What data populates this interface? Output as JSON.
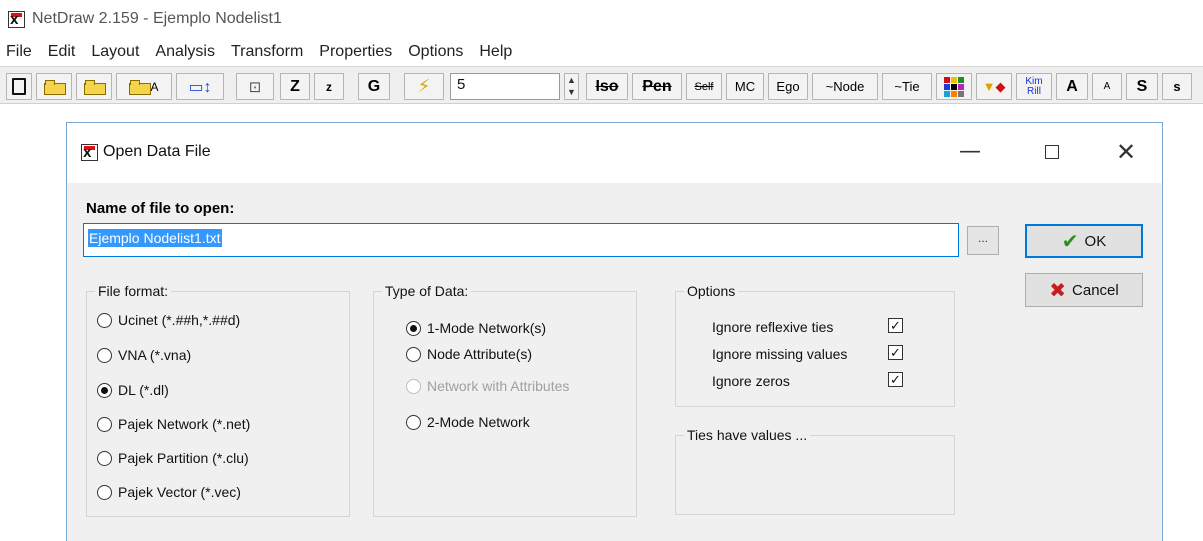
{
  "app": {
    "title": "NetDraw 2.159 - Ejemplo Nodelist1",
    "icon": "netdraw-logo-icon"
  },
  "menubar": [
    "File",
    "Edit",
    "Layout",
    "Analysis",
    "Transform",
    "Properties",
    "Options",
    "Help"
  ],
  "toolbar": {
    "icons": [
      "new-file-icon",
      "open-folder-icon",
      "open-folder-icon",
      "open-folder-attribute-icon",
      "layout-icon",
      "fit-icon"
    ],
    "z_upper": "Z",
    "z_lower": "z",
    "g": "G",
    "lightning_icon": "lightning-icon",
    "value": "5",
    "iso": "Iso",
    "pen": "Pen",
    "self": "Self",
    "mc": "MC",
    "ego": "Ego",
    "node": "~Node",
    "tie": "~Tie",
    "palette_icon": "color-palette-icon",
    "shapes_icon": "shapes-icon",
    "kim": "Kim",
    "rill": "Rill",
    "a_big": "A",
    "a_small": "A",
    "s_big": "S",
    "s_small": "s"
  },
  "dialog": {
    "title": "Open Data File",
    "name_label": "Name of file to open:",
    "filename": "Ejemplo Nodelist1.txt",
    "browse": "...",
    "ok": "OK",
    "cancel": "Cancel",
    "file_format": {
      "title": "File format:",
      "options": [
        {
          "label": "Ucinet (*.##h,*.##d)",
          "selected": false
        },
        {
          "label": "VNA (*.vna)",
          "selected": false
        },
        {
          "label": "DL (*.dl)",
          "selected": true
        },
        {
          "label": "Pajek Network (*.net)",
          "selected": false
        },
        {
          "label": "Pajek Partition (*.clu)",
          "selected": false
        },
        {
          "label": "Pajek Vector (*.vec)",
          "selected": false
        }
      ]
    },
    "type_of_data": {
      "title": "Type of Data:",
      "options": [
        {
          "label": "1-Mode Network(s)",
          "selected": true,
          "enabled": true
        },
        {
          "label": "Node Attribute(s)",
          "selected": false,
          "enabled": true
        },
        {
          "label": "Network with Attributes",
          "selected": false,
          "enabled": false
        },
        {
          "label": "2-Mode Network",
          "selected": false,
          "enabled": true
        }
      ]
    },
    "options": {
      "title": "Options",
      "items": [
        {
          "label": "Ignore reflexive ties",
          "checked": true
        },
        {
          "label": "Ignore missing values",
          "checked": true
        },
        {
          "label": "Ignore zeros",
          "checked": true
        }
      ]
    },
    "ties": {
      "title": "Ties have values ..."
    }
  }
}
